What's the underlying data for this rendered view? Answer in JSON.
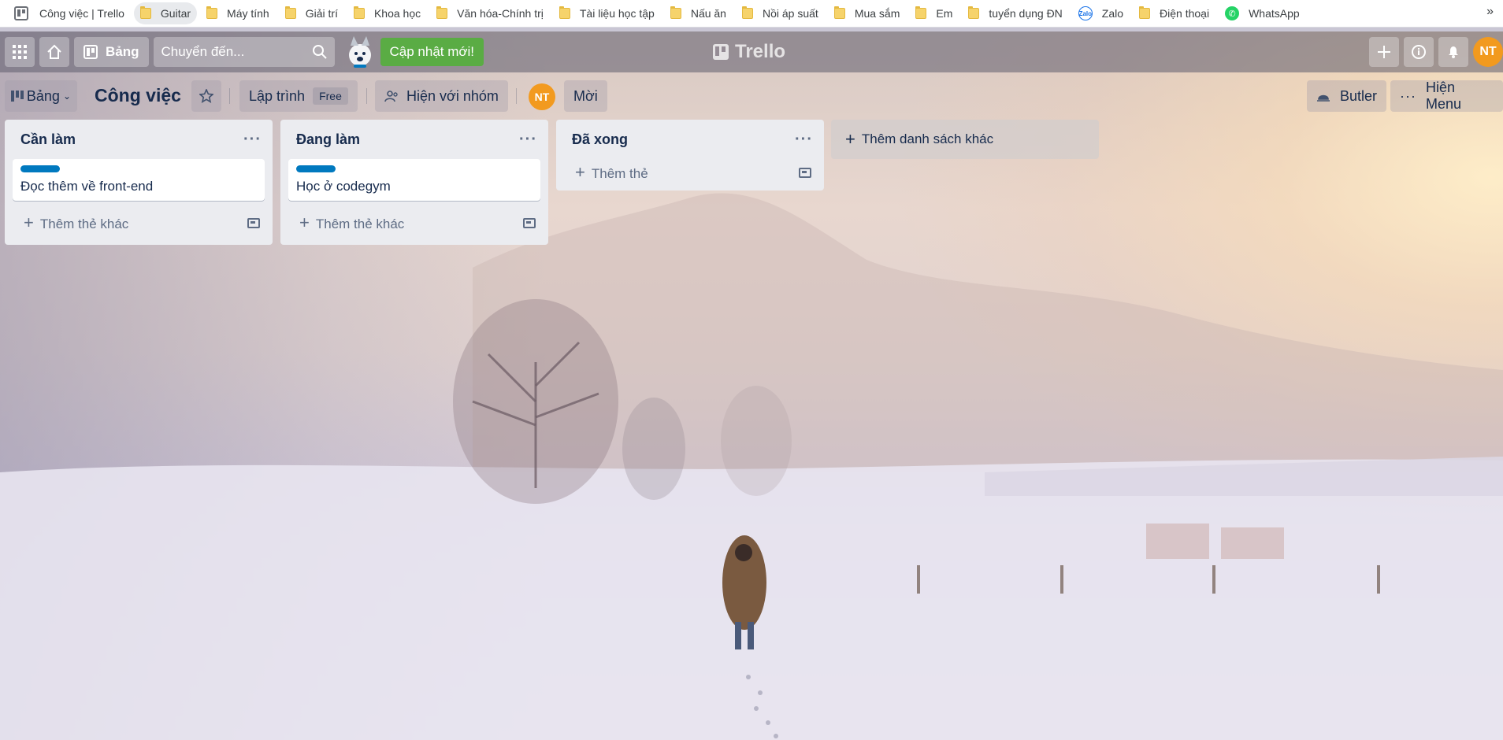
{
  "bookmarks": {
    "items": [
      {
        "label": "Công việc | Trello",
        "icon": "trello-icon"
      },
      {
        "label": "Guitar",
        "icon": "folder-icon"
      },
      {
        "label": "Máy tính",
        "icon": "folder-icon"
      },
      {
        "label": "Giải trí",
        "icon": "folder-icon"
      },
      {
        "label": "Khoa học",
        "icon": "folder-icon"
      },
      {
        "label": "Văn hóa-Chính trị",
        "icon": "folder-icon"
      },
      {
        "label": "Tài liệu học tập",
        "icon": "folder-icon"
      },
      {
        "label": "Nấu ăn",
        "icon": "folder-icon"
      },
      {
        "label": "Nồi áp suất",
        "icon": "folder-icon"
      },
      {
        "label": "Mua sắm",
        "icon": "folder-icon"
      },
      {
        "label": "Em",
        "icon": "folder-icon"
      },
      {
        "label": "tuyển dụng ĐN",
        "icon": "folder-icon"
      },
      {
        "label": "Zalo",
        "icon": "zalo-icon"
      },
      {
        "label": "Điện thoại",
        "icon": "folder-icon"
      },
      {
        "label": "WhatsApp",
        "icon": "whatsapp-icon"
      }
    ],
    "more": "»",
    "zalo_glyph": "Zalo"
  },
  "header": {
    "board_label": "Bảng",
    "search_placeholder": "Chuyển đến...",
    "update_label": "Cập nhật mới!",
    "logo": "Trello",
    "avatar": "NT"
  },
  "boardbar": {
    "view_label": "Bảng",
    "title": "Công việc",
    "team_label": "Lập trình",
    "team_badge": "Free",
    "visibility_label": "Hiện với nhóm",
    "member_avatar": "NT",
    "invite_label": "Mời",
    "butler_label": "Butler",
    "menu_label": "Hiện Menu"
  },
  "lists": [
    {
      "title": "Cần làm",
      "cards": [
        {
          "title": "Đọc thêm về front-end",
          "label_color": "#0079bf"
        }
      ],
      "add_label": "Thêm thẻ khác"
    },
    {
      "title": "Đang làm",
      "cards": [
        {
          "title": "Học ở codegym",
          "label_color": "#0079bf"
        }
      ],
      "add_label": "Thêm thẻ khác"
    },
    {
      "title": "Đã xong",
      "cards": [],
      "add_label": "Thêm thẻ"
    }
  ],
  "add_list_label": "Thêm danh sách khác",
  "colors": {
    "accent": "#0079bf",
    "update_green": "#5aac44",
    "avatar_orange": "#f29a1f"
  }
}
